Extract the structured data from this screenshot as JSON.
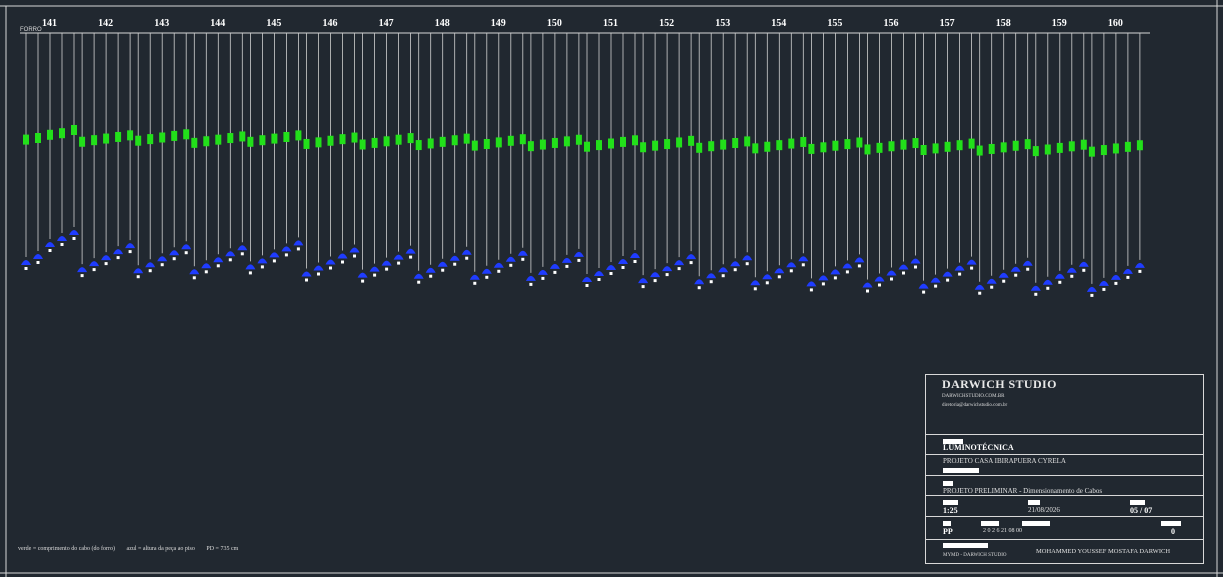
{
  "drawing": {
    "ceiling_label": "FORRO",
    "columns": [
      {
        "label": "141",
        "green": [
          4,
          5,
          7,
          8,
          10
        ],
        "blue": [
          2,
          3,
          5,
          6,
          7
        ]
      },
      {
        "label": "142",
        "green": [
          3,
          4,
          5,
          6,
          7
        ],
        "blue": [
          1,
          2,
          3,
          4,
          5
        ]
      },
      {
        "label": "143",
        "green": [
          4,
          5,
          6,
          7,
          8
        ],
        "blue": [
          1,
          2,
          3,
          4,
          5
        ]
      },
      {
        "label": "144",
        "green": [
          3,
          4,
          5,
          6,
          7
        ],
        "blue": [
          1,
          2,
          3,
          4,
          5
        ]
      },
      {
        "label": "145",
        "green": [
          4,
          5,
          6,
          7,
          8
        ],
        "blue": [
          2,
          3,
          4,
          5,
          6
        ]
      },
      {
        "label": "146",
        "green": [
          3,
          4,
          5,
          6,
          7
        ],
        "blue": [
          1,
          2,
          3,
          4,
          5
        ]
      },
      {
        "label": "147",
        "green": [
          3,
          4,
          5,
          6,
          7
        ],
        "blue": [
          1,
          2,
          3,
          4,
          5
        ]
      },
      {
        "label": "148",
        "green": [
          3,
          4,
          5,
          6,
          7
        ],
        "blue": [
          1,
          2,
          3,
          4,
          5
        ]
      },
      {
        "label": "149",
        "green": [
          3,
          4,
          5,
          6,
          7
        ],
        "blue": [
          1,
          2,
          3,
          4,
          5
        ]
      },
      {
        "label": "150",
        "green": [
          3,
          4,
          5,
          6,
          7
        ],
        "blue": [
          1,
          2,
          3,
          4,
          5
        ]
      },
      {
        "label": "151",
        "green": [
          3,
          4,
          5,
          6,
          7
        ],
        "blue": [
          1,
          2,
          3,
          4,
          5
        ]
      },
      {
        "label": "152",
        "green": [
          3,
          4,
          5,
          6,
          7
        ],
        "blue": [
          1,
          2,
          3,
          4,
          5
        ]
      },
      {
        "label": "153",
        "green": [
          3,
          4,
          5,
          6,
          7
        ],
        "blue": [
          1,
          2,
          3,
          4,
          5
        ]
      },
      {
        "label": "154",
        "green": [
          3,
          4,
          5,
          6,
          7
        ],
        "blue": [
          1,
          2,
          3,
          4,
          5
        ]
      },
      {
        "label": "155",
        "green": [
          3,
          4,
          5,
          6,
          7
        ],
        "blue": [
          1,
          2,
          3,
          4,
          5
        ]
      },
      {
        "label": "156",
        "green": [
          3,
          4,
          5,
          6,
          7
        ],
        "blue": [
          1,
          2,
          3,
          4,
          5
        ]
      },
      {
        "label": "157",
        "green": [
          3,
          4,
          5,
          6,
          7
        ],
        "blue": [
          1,
          2,
          3,
          4,
          5
        ]
      },
      {
        "label": "158",
        "green": [
          3,
          4,
          5,
          6,
          7
        ],
        "blue": [
          1,
          2,
          3,
          4,
          5
        ]
      },
      {
        "label": "159",
        "green": [
          3,
          4,
          5,
          6,
          7
        ],
        "blue": [
          1,
          2,
          3,
          4,
          5
        ]
      },
      {
        "label": "160",
        "green": [
          3,
          4,
          5,
          6,
          7
        ],
        "blue": [
          1,
          2,
          3,
          4,
          5
        ]
      }
    ],
    "colors": {
      "background": "#212830",
      "line": "#d0d0d0",
      "green": "#22e01a",
      "blue": "#1f3cff",
      "white": "#ffffff"
    }
  },
  "legend": {
    "green": "verde = comprimento do cabo (do forro)",
    "blue": "azul = altura da peça ao piso",
    "pd": "PD = 735 cm"
  },
  "title_block": {
    "studio": "DARWICH STUDIO",
    "website": "DARWICHSTUDIO.COM.BR",
    "email": "diretoria@darwichstudio.com.br",
    "discipline": "LUMINOTÉCNICA",
    "project": "PROJETO CASA IBIRAPUERA CYRELA",
    "phase": "PROJETO PRELIMINAR - Dimensionamento de Cabos",
    "scale": "1:25",
    "date": "21/08/2026",
    "sheet": "05 / 07",
    "code_prefix": "PP",
    "code_digits": "2    0    2    6    21    08    00",
    "revision": "0",
    "footer_left": "MYMD - DARWICH STUDIO",
    "footer_right": "MOHAMMED YOUSSEF MOSTAFA DARWICH"
  }
}
